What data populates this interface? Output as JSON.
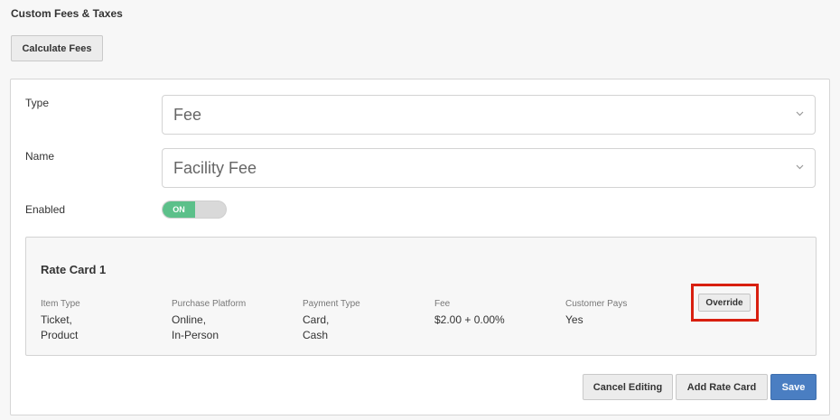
{
  "page": {
    "title": "Custom Fees & Taxes",
    "calculate_label": "Calculate Fees"
  },
  "form": {
    "type": {
      "label": "Type",
      "value": "Fee"
    },
    "name": {
      "label": "Name",
      "value": "Facility Fee"
    },
    "enabled": {
      "label": "Enabled",
      "state_text": "ON",
      "on": true
    }
  },
  "rate_card": {
    "title": "Rate Card 1",
    "columns": [
      {
        "header": "Item Type",
        "values": [
          "Ticket,",
          "Product"
        ]
      },
      {
        "header": "Purchase Platform",
        "values": [
          "Online,",
          "In-Person"
        ]
      },
      {
        "header": "Payment Type",
        "values": [
          "Card,",
          "Cash"
        ]
      },
      {
        "header": "Fee",
        "values": [
          "$2.00 + 0.00%"
        ]
      },
      {
        "header": "Customer Pays",
        "values": [
          "Yes"
        ]
      }
    ],
    "override_label": "Override"
  },
  "actions": {
    "cancel_label": "Cancel Editing",
    "add_label": "Add Rate Card",
    "save_label": "Save"
  },
  "colors": {
    "toggle_on": "#5cc08a",
    "primary": "#4a7ec2",
    "highlight": "#d81f0f"
  }
}
